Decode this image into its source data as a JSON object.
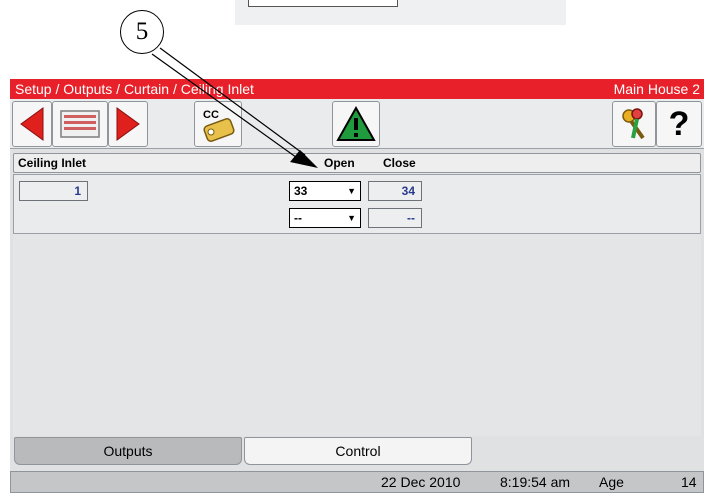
{
  "callout": {
    "number": "5"
  },
  "window": {
    "breadcrumb": "Setup / Outputs / Curtain / Ceiling Inlet",
    "house": "Main House 2"
  },
  "toolbar": {
    "cc_label": "CC",
    "help_label": "?"
  },
  "table": {
    "headers": {
      "name": "Ceiling Inlet",
      "open": "Open",
      "close": "Close"
    },
    "rows": [
      {
        "id": "1",
        "open": "33",
        "close": "34"
      },
      {
        "id": "",
        "open": "--",
        "close": "--"
      }
    ]
  },
  "tabs": [
    {
      "label": "Outputs",
      "active": true
    },
    {
      "label": "Control",
      "active": false
    }
  ],
  "status": {
    "date": "22 Dec 2010",
    "time": "8:19:54 am",
    "age_label": "Age",
    "age_value": "14"
  },
  "colors": {
    "titlebar": "#e8202a",
    "nav_arrow": "#e0201c",
    "warning": "#1f9a3c",
    "value_text": "#2a3a8a"
  }
}
